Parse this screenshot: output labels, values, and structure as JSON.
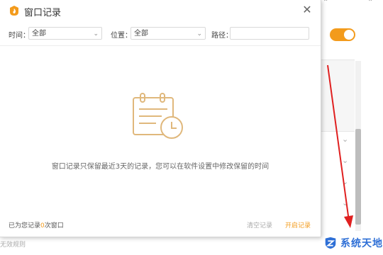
{
  "background": {
    "footer_text": "无效规则",
    "watermark_text": "系统天地",
    "accent_color": "#f39b1c"
  },
  "dialog": {
    "title": "窗口记录",
    "close_icon": "close-icon",
    "filters": {
      "time_label": "时间：",
      "time_value": "全部",
      "location_label": "位置：",
      "location_value": "全部",
      "path_label": "路径：",
      "path_value": ""
    },
    "empty_message": "窗口记录只保留最近3天的记录，您可以在软件设置中修改保留的时间",
    "footer": {
      "count_prefix": "已为您记录",
      "count_value": "0",
      "count_suffix": "次窗口",
      "clear_label": "清空记录",
      "open_label": "开启记录"
    }
  },
  "colors": {
    "accent": "#f39b1c",
    "annotation_arrow": "#e02020",
    "watermark": "#2e6fd6"
  }
}
